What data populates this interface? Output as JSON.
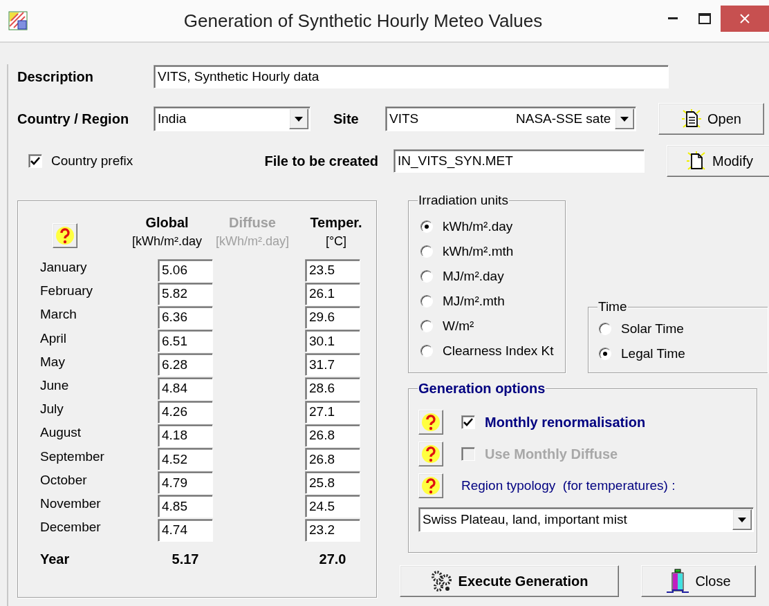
{
  "window": {
    "title": "Generation of Synthetic Hourly Meteo Values"
  },
  "description": {
    "label": "Description",
    "value": "VITS, Synthetic Hourly data"
  },
  "country": {
    "label": "Country / Region",
    "value": "India"
  },
  "site": {
    "label": "Site",
    "name": "VITS",
    "source": "NASA-SSE sate"
  },
  "country_prefix": {
    "label": "Country prefix",
    "checked": true
  },
  "output_file": {
    "label": "File to be created",
    "value": "IN_VITS_SYN.MET"
  },
  "side_buttons": [
    {
      "kind": "open",
      "label": "Open"
    },
    {
      "kind": "modify",
      "label": "Modify"
    }
  ],
  "monthly_values": {
    "columns": [
      {
        "title": "Global",
        "unit": "[kWh/m².day",
        "disabled": false
      },
      {
        "title": "Diffuse",
        "unit": "[kWh/m².day]",
        "disabled": true
      },
      {
        "title": "Temper.",
        "unit": "[°C]",
        "disabled": false
      }
    ],
    "rows": [
      {
        "month": "January",
        "global": "5.06",
        "temperature": "23.5"
      },
      {
        "month": "February",
        "global": "5.82",
        "temperature": "26.1"
      },
      {
        "month": "March",
        "global": "6.36",
        "temperature": "29.6"
      },
      {
        "month": "April",
        "global": "6.51",
        "temperature": "30.1"
      },
      {
        "month": "May",
        "global": "6.28",
        "temperature": "31.7"
      },
      {
        "month": "June",
        "global": "4.84",
        "temperature": "28.6"
      },
      {
        "month": "July",
        "global": "4.26",
        "temperature": "27.1"
      },
      {
        "month": "August",
        "global": "4.18",
        "temperature": "26.8"
      },
      {
        "month": "September",
        "global": "4.52",
        "temperature": "26.8"
      },
      {
        "month": "October",
        "global": "4.79",
        "temperature": "25.8"
      },
      {
        "month": "November",
        "global": "4.85",
        "temperature": "24.5"
      },
      {
        "month": "December",
        "global": "4.74",
        "temperature": "23.2"
      }
    ],
    "year": {
      "label": "Year",
      "global": "5.17",
      "temperature": "27.0"
    }
  },
  "irradiation_units": {
    "title": "Irradiation units",
    "options": [
      {
        "label": "kWh/m².day",
        "selected": true
      },
      {
        "label": "kWh/m².mth",
        "selected": false
      },
      {
        "label": "MJ/m².day",
        "selected": false
      },
      {
        "label": "MJ/m².mth",
        "selected": false
      },
      {
        "label": "W/m²",
        "selected": false
      },
      {
        "label": "Clearness Index Kt",
        "selected": false
      }
    ]
  },
  "time": {
    "title": "Time",
    "options": [
      {
        "label": "Solar Time",
        "selected": false
      },
      {
        "label": "Legal Time",
        "selected": true
      }
    ]
  },
  "generation_options": {
    "title": "Generation options",
    "items": [
      {
        "kind": "checkbox",
        "label": "Monthly renormalisation",
        "checked": true,
        "disabled": false
      },
      {
        "kind": "checkbox",
        "label": "Use Monthly Diffuse",
        "checked": false,
        "disabled": true
      },
      {
        "kind": "label",
        "label": "Region typology  (for temperatures) :"
      }
    ],
    "region_typology": "Swiss Plateau, land, important mist"
  },
  "buttons": [
    {
      "kind": "execute",
      "label": "Execute Generation"
    },
    {
      "kind": "close",
      "label": "Close"
    }
  ]
}
